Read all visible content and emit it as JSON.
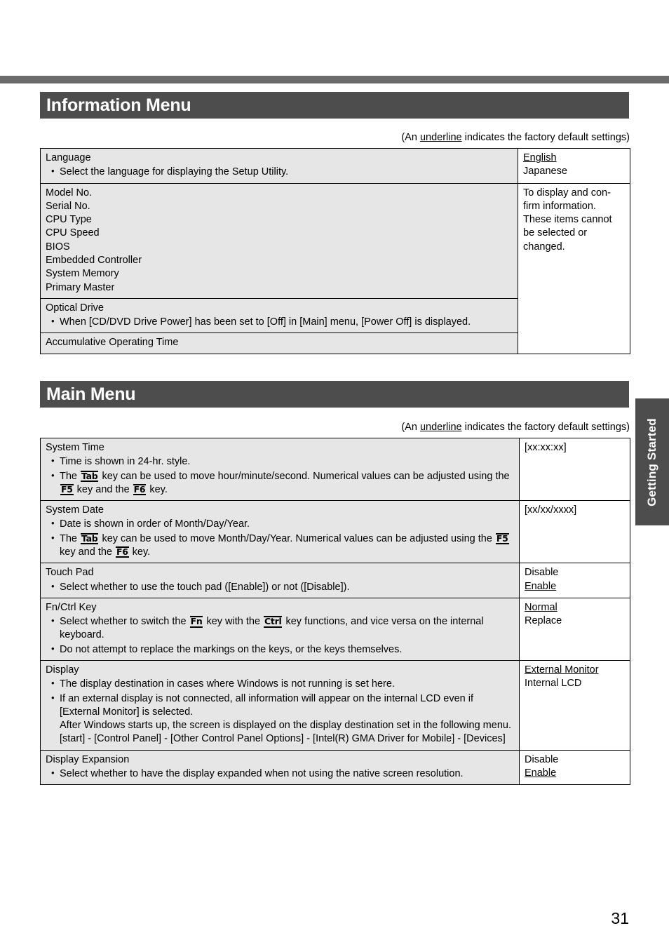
{
  "page": {
    "number": "31",
    "side_tab_label": "Getting Started",
    "accent_dark": "#4d4d4d",
    "rule_gray": "#6b6b6b",
    "cell_gray": "#e6e6e6"
  },
  "sections": [
    {
      "title": "Information Menu",
      "caption_pre": "(An ",
      "caption_underlined": "underline",
      "caption_post": " indicates the factory default settings)"
    },
    {
      "title": "Main Menu",
      "caption_pre": "(An ",
      "caption_underlined": "underline",
      "caption_post": " indicates the factory default settings)"
    }
  ],
  "info_table": {
    "row1": {
      "title": "Language",
      "bullet1": "Select the language for displaying the Setup Utility.",
      "value_default": "English",
      "value_other": "Japanese"
    },
    "row2": {
      "lines": [
        "Model No.",
        "Serial No.",
        "CPU Type",
        "CPU Speed",
        "BIOS",
        "Embedded Controller",
        "System Memory",
        "Primary Master"
      ],
      "value_text": "To display and con-firm information. These items cannot be selected or changed.",
      "value_l1": "To display and con-",
      "value_l2": "firm information.",
      "value_l3": "These items cannot",
      "value_l4": "be selected or",
      "value_l5": "changed."
    },
    "row3": {
      "title": "Optical Drive",
      "bullet1": "When [CD/DVD Drive Power] has been set to [Off] in [Main] menu, [Power Off] is displayed."
    },
    "row4": {
      "title": "Accumulative Operating Time"
    }
  },
  "main_table": {
    "system_time": {
      "title": "System Time",
      "bullet1": "Time is shown in 24-hr. style.",
      "bullet2_a": "The ",
      "bullet2_key1": "Tab",
      "bullet2_b": " key can be used to move hour/minute/second. Numerical values can be adjusted using the ",
      "bullet2_key2": "F5",
      "bullet2_c": " key and the ",
      "bullet2_key3": "F6",
      "bullet2_d": " key.",
      "value": "[xx:xx:xx]"
    },
    "system_date": {
      "title": "System Date",
      "bullet1": "Date is shown in order of Month/Day/Year.",
      "bullet2_a": "The ",
      "bullet2_key1": "Tab",
      "bullet2_b": " key can be used to move Month/Day/Year. Numerical values can be adjusted using the ",
      "bullet2_key2": "F5",
      "bullet2_c": " key and the ",
      "bullet2_key3": "F6",
      "bullet2_d": " key.",
      "value": "[xx/xx/xxxx]"
    },
    "touch_pad": {
      "title": "Touch Pad",
      "bullet1": "Select whether to use the touch pad ([Enable]) or not ([Disable]).",
      "value_other": "Disable",
      "value_default": "Enable"
    },
    "fn_ctrl": {
      "title": "Fn/Ctrl Key",
      "bullet1_a": "Select whether to switch the ",
      "bullet1_key1": "Fn",
      "bullet1_b": " key with the ",
      "bullet1_key2": "Ctrl",
      "bullet1_c": " key functions, and vice versa on the internal keyboard.",
      "bullet2": "Do not attempt to replace the markings on the keys, or the keys themselves.",
      "value_default": "Normal",
      "value_other": "Replace"
    },
    "display": {
      "title": "Display",
      "bullet1": "The display destination in cases where Windows is not running is set here.",
      "bullet2_l1": "If an external display is not connected, all information will appear on the internal LCD even if [External Monitor] is selected.",
      "bullet2_l2": "After Windows starts up, the screen is displayed on the display destination set in the following menu.",
      "bullet2_l3": "[start] - [Control Panel] - [Other Control Panel Options] - [Intel(R) GMA Driver for Mobile] - [Devices]",
      "value_default": "External Monitor",
      "value_other": "Internal LCD"
    },
    "display_expansion": {
      "title": "Display Expansion",
      "bullet1": "Select whether to have the display expanded when not using the native screen resolution.",
      "value_other": "Disable",
      "value_default": "Enable"
    }
  }
}
